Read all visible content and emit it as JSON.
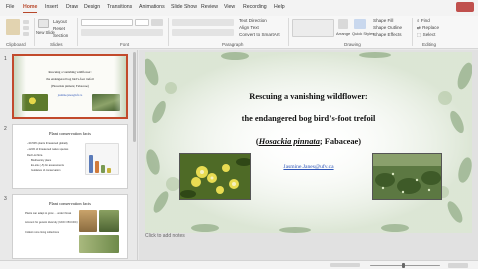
{
  "ribbon": {
    "tabs": [
      "File",
      "Home",
      "Insert",
      "Draw",
      "Design",
      "Transitions",
      "Animations",
      "Slide Show",
      "Review",
      "View",
      "Recording",
      "Help"
    ],
    "active_tab": "Home",
    "groups": {
      "clipboard": "Clipboard",
      "slides": "Slides",
      "font": "Font",
      "paragraph": "Paragraph",
      "drawing": "Drawing",
      "editing": "Editing"
    },
    "new_slide": "New Slide",
    "layout": "Layout",
    "reset": "Reset",
    "section": "Section",
    "text_direction": "Text Direction",
    "align_text": "Align Text",
    "convert_smartart": "Convert to SmartArt",
    "arrange": "Arrange",
    "quick_styles": "Quick Styles",
    "shape_fill": "Shape Fill",
    "shape_outline": "Shape Outline",
    "shape_effects": "Shape Effects",
    "find": "Find",
    "replace": "Replace",
    "select": "Select"
  },
  "thumbnails": [
    {
      "number": "1",
      "title_lines": [
        "Rescuing a vanishing wildflower:",
        "the endangered bog bird's-foot trefoil",
        "(Hosackia pinnata; Fabaceae)"
      ],
      "email": "jasmine.janes@ufv.ca"
    },
    {
      "number": "2",
      "title": "Plant conservation facts",
      "bullets": [
        "~30-50% plants threatened globally",
        "~124% of threatened native species",
        "Red List flora",
        "Biodiversity plans",
        "Ex-situ (~5) for assessments",
        "Guidance of conservation"
      ]
    },
    {
      "number": "3",
      "title": "Plant conservation facts",
      "bullets": [
        "Plants can adapt to grow ... under threat",
        "Account for genetic diversity (IUCN / BCCDC)",
        "Collect more living collections"
      ]
    }
  ],
  "slide": {
    "title_line1": "Rescuing a vanishing wildflower:",
    "title_line2": "the endangered bog bird's-foot trefoil",
    "title_line3_open": "(",
    "title_line3_italic": "Hosackia pinnata",
    "title_line3_rest": "; Fabaceae)",
    "email": "Jasmine.Janes@ufv.ca"
  },
  "notes_placeholder": "Click to add notes",
  "colors": {
    "accent": "#b7472a",
    "link": "#2e56b8",
    "leaf": "#7a9a6e"
  }
}
